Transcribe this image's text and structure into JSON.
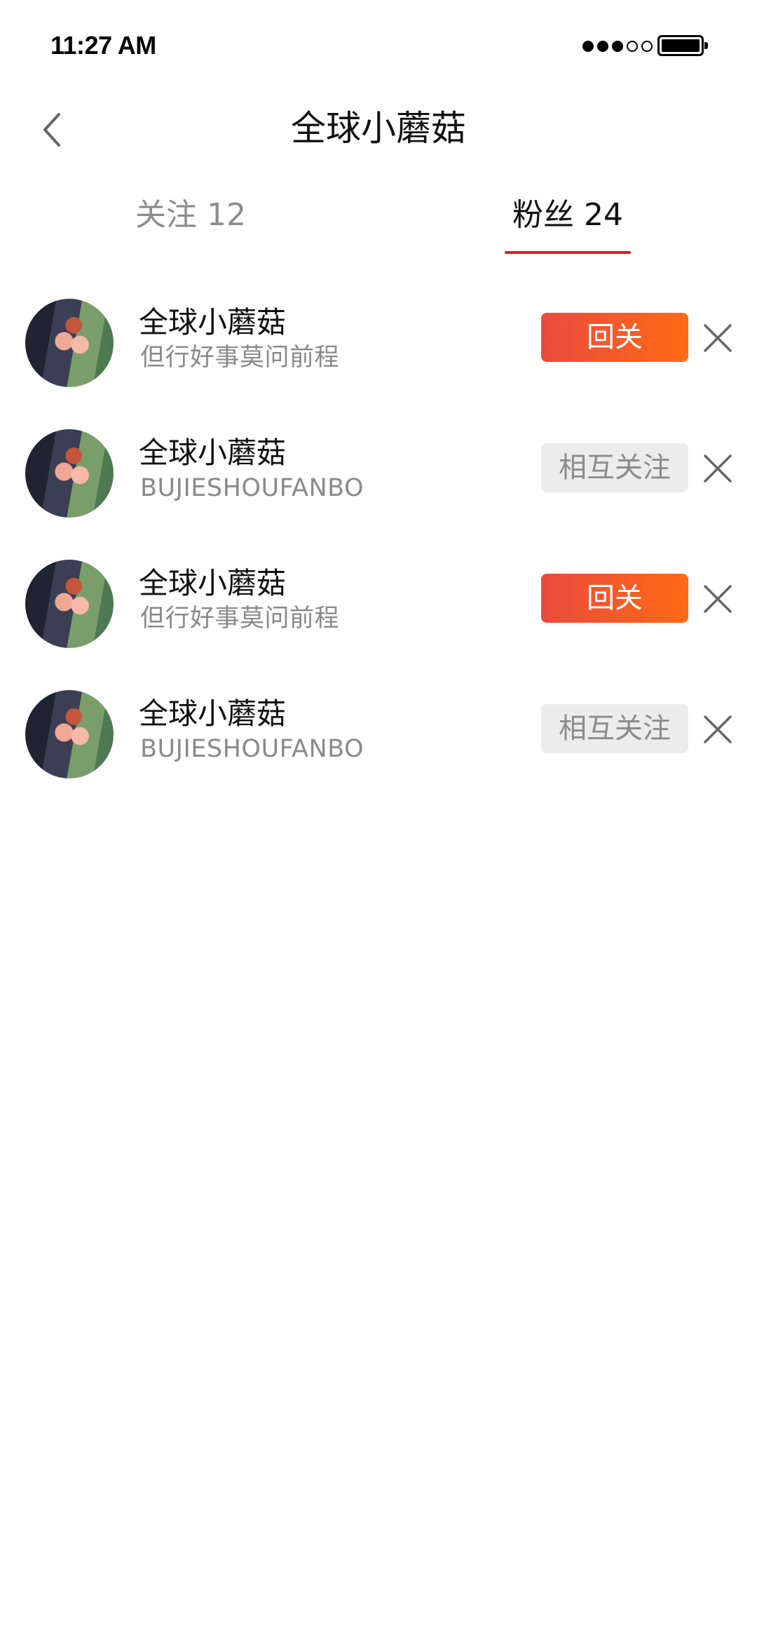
{
  "status_bar": {
    "time": "11:27 AM",
    "signal_filled": 3,
    "signal_total": 5,
    "battery_level": 1.0
  },
  "header": {
    "title": "全球小蘑菇",
    "back_icon": "chevron-left-icon"
  },
  "tabs": [
    {
      "label": "关注 12",
      "active": false
    },
    {
      "label": "粉丝 24",
      "active": true
    }
  ],
  "colors": {
    "accent": "#e21a1a",
    "follow_gradient_start": "#ea4a3d",
    "follow_gradient_end": "#ff6a15",
    "muted_text": "#8a8a8a",
    "mutual_bg": "#ececec"
  },
  "fans": [
    {
      "name": "全球小蘑菇",
      "subtitle": "但行好事莫问前程",
      "action": "回关",
      "action_type": "follow-back"
    },
    {
      "name": "全球小蘑菇",
      "subtitle": "BUJIESHOUFANBO",
      "action": "相互关注",
      "action_type": "mutual"
    },
    {
      "name": "全球小蘑菇",
      "subtitle": "但行好事莫问前程",
      "action": "回关",
      "action_type": "follow-back"
    },
    {
      "name": "全球小蘑菇",
      "subtitle": "BUJIESHOUFANBO",
      "action": "相互关注",
      "action_type": "mutual"
    }
  ]
}
